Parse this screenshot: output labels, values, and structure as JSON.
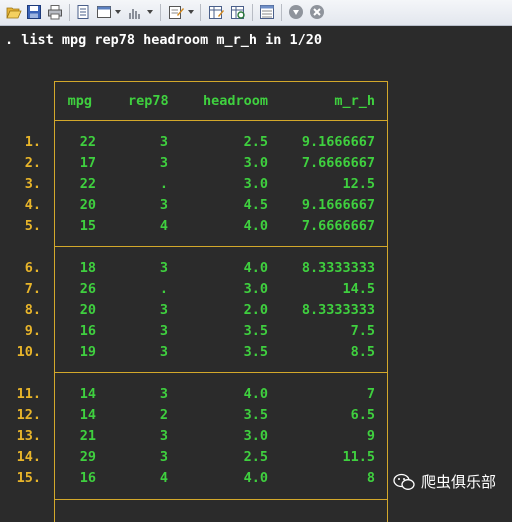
{
  "toolbar": {
    "icons": [
      "open-icon",
      "save-icon",
      "print-icon",
      "log-icon",
      "viewer-icon",
      "graph-icon",
      "do-file-editor-icon",
      "data-editor-icon",
      "data-browser-icon",
      "variables-manager-icon",
      "break-icon",
      "clear-icon"
    ]
  },
  "command": ". list mpg rep78 headroom m_r_h in 1/20",
  "table": {
    "headers": [
      "mpg",
      "rep78",
      "headroom",
      "m_r_h"
    ],
    "rows": [
      {
        "num": "1.",
        "mpg": "22",
        "rep78": "3",
        "headroom": "2.5",
        "mrh": "9.1666667"
      },
      {
        "num": "2.",
        "mpg": "17",
        "rep78": "3",
        "headroom": "3.0",
        "mrh": "7.6666667"
      },
      {
        "num": "3.",
        "mpg": "22",
        "rep78": ".",
        "headroom": "3.0",
        "mrh": "12.5"
      },
      {
        "num": "4.",
        "mpg": "20",
        "rep78": "3",
        "headroom": "4.5",
        "mrh": "9.1666667"
      },
      {
        "num": "5.",
        "mpg": "15",
        "rep78": "4",
        "headroom": "4.0",
        "mrh": "7.6666667"
      },
      {
        "num": "6.",
        "mpg": "18",
        "rep78": "3",
        "headroom": "4.0",
        "mrh": "8.3333333"
      },
      {
        "num": "7.",
        "mpg": "26",
        "rep78": ".",
        "headroom": "3.0",
        "mrh": "14.5"
      },
      {
        "num": "8.",
        "mpg": "20",
        "rep78": "3",
        "headroom": "2.0",
        "mrh": "8.3333333"
      },
      {
        "num": "9.",
        "mpg": "16",
        "rep78": "3",
        "headroom": "3.5",
        "mrh": "7.5"
      },
      {
        "num": "10.",
        "mpg": "19",
        "rep78": "3",
        "headroom": "3.5",
        "mrh": "8.5"
      },
      {
        "num": "11.",
        "mpg": "14",
        "rep78": "3",
        "headroom": "4.0",
        "mrh": "7"
      },
      {
        "num": "12.",
        "mpg": "14",
        "rep78": "2",
        "headroom": "3.5",
        "mrh": "6.5"
      },
      {
        "num": "13.",
        "mpg": "21",
        "rep78": "3",
        "headroom": "3.0",
        "mrh": "9"
      },
      {
        "num": "14.",
        "mpg": "29",
        "rep78": "3",
        "headroom": "2.5",
        "mrh": "11.5"
      },
      {
        "num": "15.",
        "mpg": "16",
        "rep78": "4",
        "headroom": "4.0",
        "mrh": "8"
      }
    ]
  },
  "watermark": {
    "text": "爬虫俱乐部"
  },
  "colors": {
    "background": "#2b2b2b",
    "data_text": "#3fd03f",
    "row_number": "#e8b52a",
    "border": "#d3a82b",
    "command_text": "#ffffff"
  }
}
